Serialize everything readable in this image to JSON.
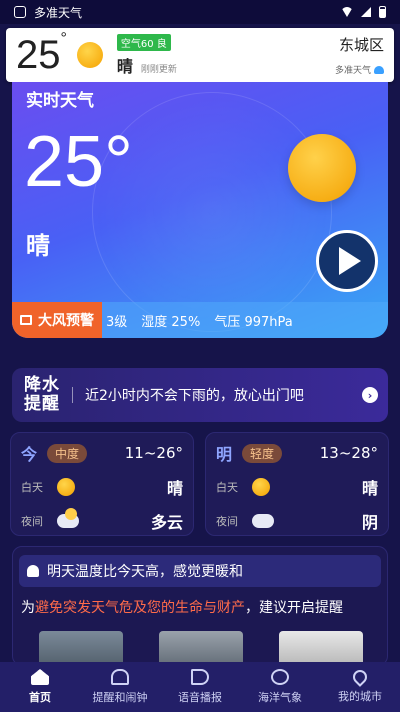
{
  "status_bar": {
    "app_name": "多准天气"
  },
  "widget": {
    "temperature": "25",
    "degree_symbol": "°",
    "aqi": "空气60 良",
    "condition": "晴",
    "update_text": "刚刚更新",
    "district": "东城区",
    "brand": "多准天气"
  },
  "hero": {
    "title": "实时天气",
    "temperature": "25°",
    "condition": "晴",
    "warning": "大风预警",
    "wind_partial": "3级",
    "humidity": "湿度 25%",
    "pressure": "气压 997hPa"
  },
  "rain_reminder": {
    "badge": "降水提醒",
    "message": "近2小时内不会下雨的，放心出门吧"
  },
  "today": {
    "day": "今",
    "aqi": "中度",
    "range": "11~26°",
    "day_label": "白天",
    "day_weather": "晴",
    "night_label": "夜间",
    "night_weather": "多云"
  },
  "tomorrow": {
    "day": "明",
    "aqi": "轻度",
    "range": "13~28°",
    "day_label": "白天",
    "day_weather": "晴",
    "night_label": "夜间",
    "night_weather": "阴"
  },
  "remind_panel": {
    "notice": "明天温度比今天高，感觉更暖和",
    "advice_prefix": "为",
    "advice_highlight": "避免突发天气危及您的生命与财产",
    "advice_suffix": "，建议开启提醒"
  },
  "bottom_nav": {
    "items": [
      {
        "label": "首页"
      },
      {
        "label": "提醒和闹钟"
      },
      {
        "label": "语音播报"
      },
      {
        "label": "海洋气象"
      },
      {
        "label": "我的城市"
      }
    ]
  },
  "colors": {
    "background": "#16144a",
    "warning": "#f0632a",
    "highlight": "#ff6b4a",
    "aqi_good": "#2eb84b"
  }
}
